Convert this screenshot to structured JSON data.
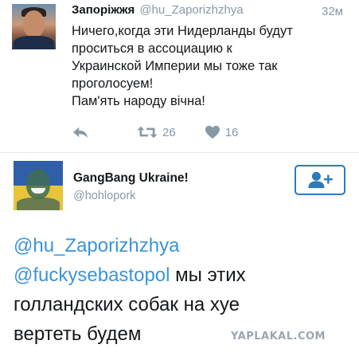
{
  "tweet1": {
    "display_name": "Запоріжжя",
    "handle": "@hu_Zaporizhzhya",
    "time": "32м",
    "lines": [
      "Ничего,когда эти Нидерланды будут",
      "проситься в ассоциацию к",
      "Украинской Империи мы тоже так",
      "проголосуем!",
      "Пам'ять народу вічна!"
    ],
    "retweets": "26",
    "likes": "16",
    "icons": [
      "reply-icon",
      "retweet-icon",
      "heart-icon"
    ]
  },
  "tweet2": {
    "display_name": "GangBang Ukraine!",
    "handle": "@hohlopork",
    "follow_icon": "add-user-icon",
    "mention1": "@hu_Zaporizhzhya",
    "mention2": "@fuckysebastopol",
    "text_after_mention2": " мы этих",
    "line3": "голландских собак на хуе",
    "line4": "вертеть будем"
  },
  "watermark": "YAPLAKAL.COM",
  "colors": {
    "link": "#3b94d9",
    "muted": "#8899a6",
    "follow_border": "#2b7bb9",
    "divider": "#e1e8ed"
  }
}
